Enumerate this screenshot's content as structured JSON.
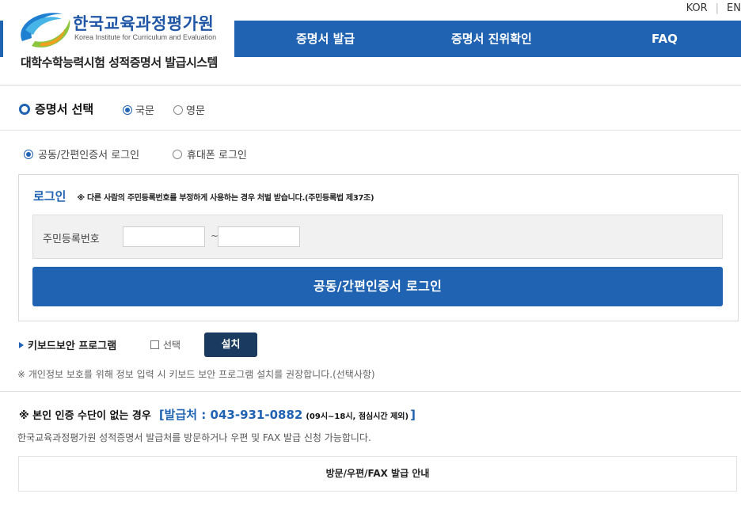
{
  "header": {
    "lang_kor": "KOR",
    "lang_sep": "|",
    "lang_en": "EN",
    "org_name_ko": "한국교육과정평가원",
    "org_name_en": "Korea Institute for Curriculum and Evaluation",
    "system_name": "대학수학능력시험 성적증명서 발급시스템"
  },
  "nav": {
    "items": [
      {
        "label": "증명서 발급"
      },
      {
        "label": "증명서 진위확인"
      },
      {
        "label": "FAQ"
      }
    ]
  },
  "certificate": {
    "title": "증명서 선택",
    "lang_options": [
      {
        "label": "국문",
        "selected": true
      },
      {
        "label": "영문",
        "selected": false
      }
    ]
  },
  "login_method": {
    "options": [
      {
        "label": "공동/간편인증서 로그인",
        "selected": true
      },
      {
        "label": "휴대폰 로그인",
        "selected": false
      }
    ]
  },
  "login": {
    "title": "로그인",
    "notice": "※ 다른 사람의 주민등록번호를 부정하게 사용하는 경우 처벌 받습니다.(주민등록법 제37조)",
    "id_label": "주민등록번호",
    "id_first_value": "",
    "id_second_value": "",
    "separator": "~",
    "button_label": "공동/간편인증서 로그인"
  },
  "keyboard": {
    "title": "키보드보안 프로그램",
    "checkbox_label": "선택",
    "install_label": "설치",
    "note": "※ 개인정보 보호를 위해 정보 입력 시 키보드 보안 프로그램 설치를 권장합니다.(선택사항)"
  },
  "no_auth": {
    "title": "※ 본인 인증 수단이 없는 경우",
    "phone": "[발급처 : 043-931-0882",
    "hours": "(09시~18시, 점심시간 제외)",
    "bracket_close": "]",
    "description": "한국교육과정평가원 성적증명서 발급처를 방문하거나 우편 및 FAX 발급 신청 가능합니다.",
    "guide_label": "방문/우편/FAX 발급 안내"
  },
  "colors": {
    "primary": "#1f63b2",
    "install_button": "#1b3a5f"
  },
  "icons": [
    "logo-mark-icon",
    "ring-bullet-icon",
    "triangle-bullet-icon",
    "radio-icon",
    "checkbox-icon"
  ]
}
